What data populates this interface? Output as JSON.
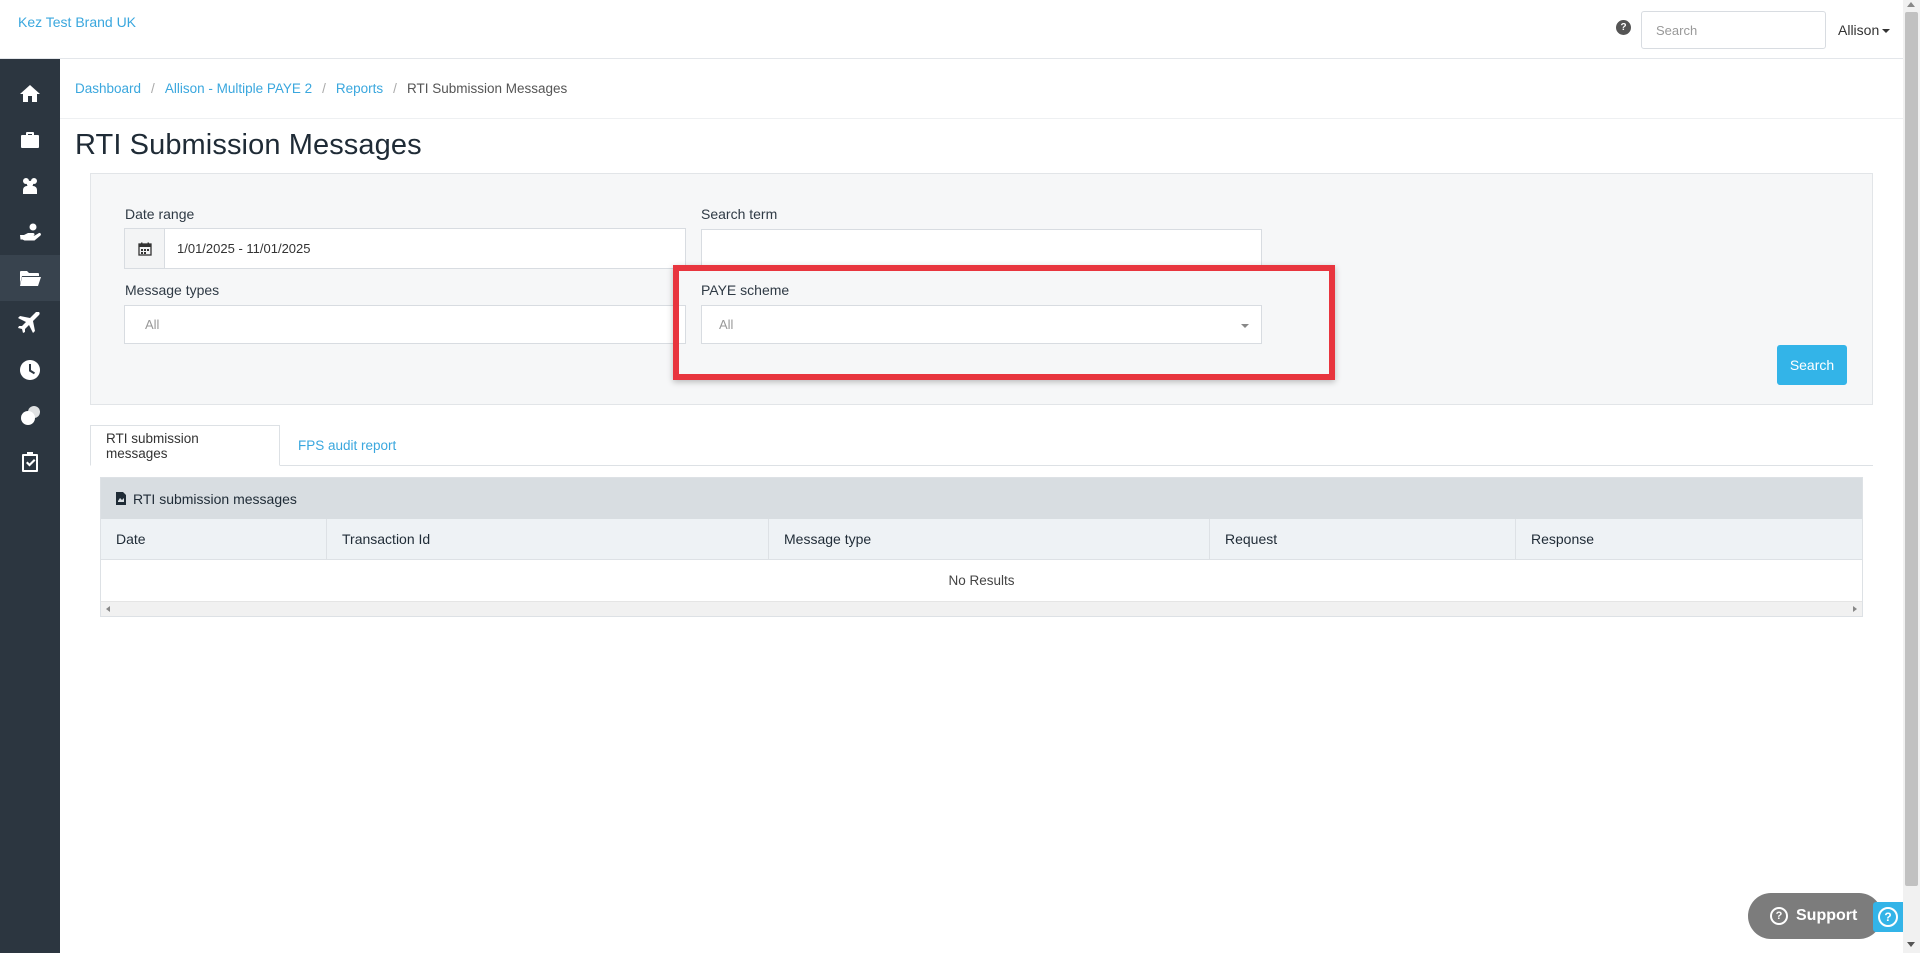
{
  "header": {
    "brand": "Kez Test Brand UK",
    "help_icon": "question-circle-icon",
    "search_placeholder": "Search",
    "user_name": "Allison"
  },
  "sidebar": {
    "items": [
      {
        "icon": "home-icon"
      },
      {
        "icon": "briefcase-icon"
      },
      {
        "icon": "users-icon"
      },
      {
        "icon": "hand-holding-icon"
      },
      {
        "icon": "folder-open-icon",
        "active": true
      },
      {
        "icon": "plane-icon"
      },
      {
        "icon": "clock-icon"
      },
      {
        "icon": "coins-icon"
      },
      {
        "icon": "clipboard-check-icon"
      }
    ]
  },
  "breadcrumb": {
    "items": [
      "Dashboard",
      "Allison - Multiple PAYE 2",
      "Reports"
    ],
    "current": "RTI Submission Messages",
    "separator": "/"
  },
  "page": {
    "title": "RTI Submission Messages"
  },
  "filters": {
    "date_range": {
      "label": "Date range",
      "value": "1/01/2025 - 11/01/2025",
      "icon": "calendar-icon"
    },
    "search_term": {
      "label": "Search term",
      "value": ""
    },
    "message_types": {
      "label": "Message types",
      "value": "All"
    },
    "paye_scheme": {
      "label": "PAYE scheme",
      "value": "All"
    },
    "search_button": "Search"
  },
  "tabs": [
    {
      "label": "RTI submission messages",
      "active": true
    },
    {
      "label": "FPS audit report",
      "active": false
    }
  ],
  "table": {
    "title": "RTI submission messages",
    "title_icon": "file-icon",
    "columns": [
      "Date",
      "Transaction Id",
      "Message type",
      "Request",
      "Response"
    ],
    "empty_text": "No Results"
  },
  "support": {
    "label": "Support"
  },
  "colors": {
    "accent": "#33b4e8",
    "sidebar": "#2c3640",
    "highlight": "#e8353e"
  }
}
